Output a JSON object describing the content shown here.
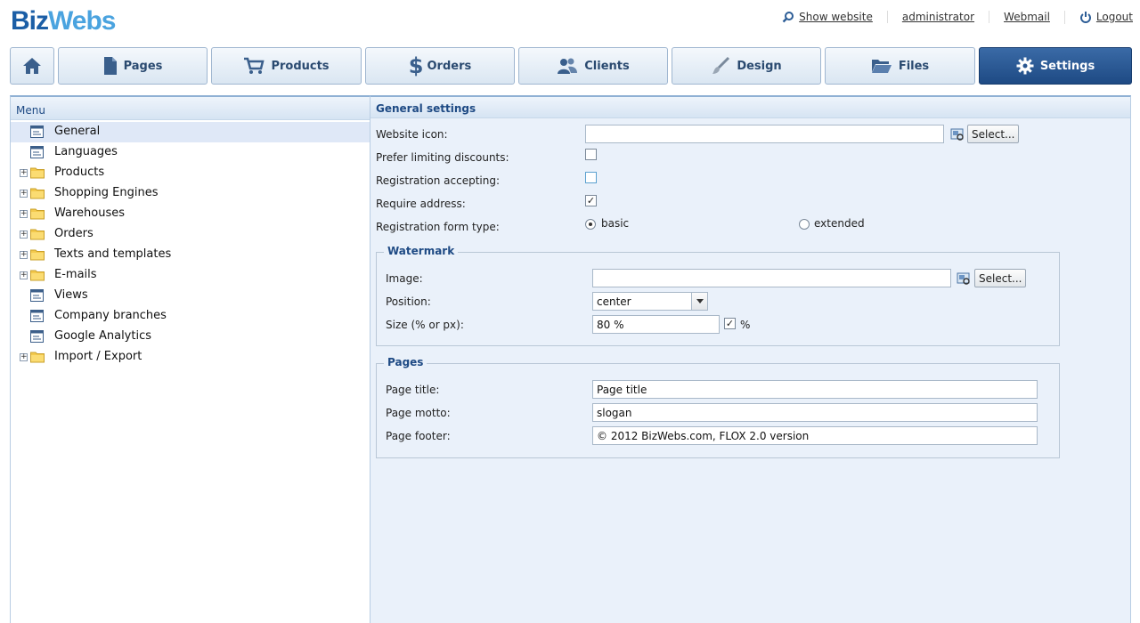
{
  "header": {
    "logo_part1": "Biz",
    "logo_part2": "Webs",
    "links": {
      "show_website": "Show website",
      "administrator": "administrator",
      "webmail": "Webmail",
      "logout": "Logout"
    }
  },
  "nav": {
    "pages": "Pages",
    "products": "Products",
    "orders": "Orders",
    "clients": "Clients",
    "design": "Design",
    "files": "Files",
    "settings": "Settings",
    "active": "settings"
  },
  "sidebar": {
    "title": "Menu",
    "items": [
      {
        "label": "General",
        "type": "page",
        "expandable": false,
        "active": true
      },
      {
        "label": "Languages",
        "type": "page",
        "expandable": false
      },
      {
        "label": "Products",
        "type": "folder",
        "expandable": true
      },
      {
        "label": "Shopping Engines",
        "type": "folder",
        "expandable": true
      },
      {
        "label": "Warehouses",
        "type": "folder",
        "expandable": true
      },
      {
        "label": "Orders",
        "type": "folder",
        "expandable": true
      },
      {
        "label": "Texts and templates",
        "type": "folder",
        "expandable": true
      },
      {
        "label": "E-mails",
        "type": "folder",
        "expandable": true
      },
      {
        "label": "Views",
        "type": "page",
        "expandable": false
      },
      {
        "label": "Company branches",
        "type": "page",
        "expandable": false
      },
      {
        "label": "Google Analytics",
        "type": "page",
        "expandable": false
      },
      {
        "label": "Import / Export",
        "type": "folder",
        "expandable": true
      }
    ]
  },
  "general": {
    "title": "General settings",
    "website_icon_label": "Website icon:",
    "website_icon_value": "",
    "select_button": "Select...",
    "prefer_limiting_label": "Prefer limiting discounts:",
    "prefer_limiting_checked": false,
    "registration_accepting_label": "Registration accepting:",
    "registration_accepting_checked": false,
    "require_address_label": "Require address:",
    "require_address_checked": true,
    "registration_form_label": "Registration form type:",
    "form_type_basic": "basic",
    "form_type_extended": "extended",
    "form_type_selected": "basic"
  },
  "watermark": {
    "legend": "Watermark",
    "image_label": "Image:",
    "image_value": "",
    "select_button": "Select...",
    "position_label": "Position:",
    "position_value": "center",
    "size_label": "Size (% or px):",
    "size_value": "80 %",
    "percent_checked": true,
    "percent_label": "%"
  },
  "pages_section": {
    "legend": "Pages",
    "title_label": "Page title:",
    "title_value": "Page title",
    "motto_label": "Page motto:",
    "motto_value": "slogan",
    "footer_label": "Page footer:",
    "footer_value": "© 2012 BizWebs.com, FLOX 2.0 version"
  },
  "colors": {
    "accent": "#1e4a84",
    "logo_dark": "#1b5ea6",
    "logo_light": "#4aa3df",
    "panel_bg": "#eaf1fa"
  }
}
